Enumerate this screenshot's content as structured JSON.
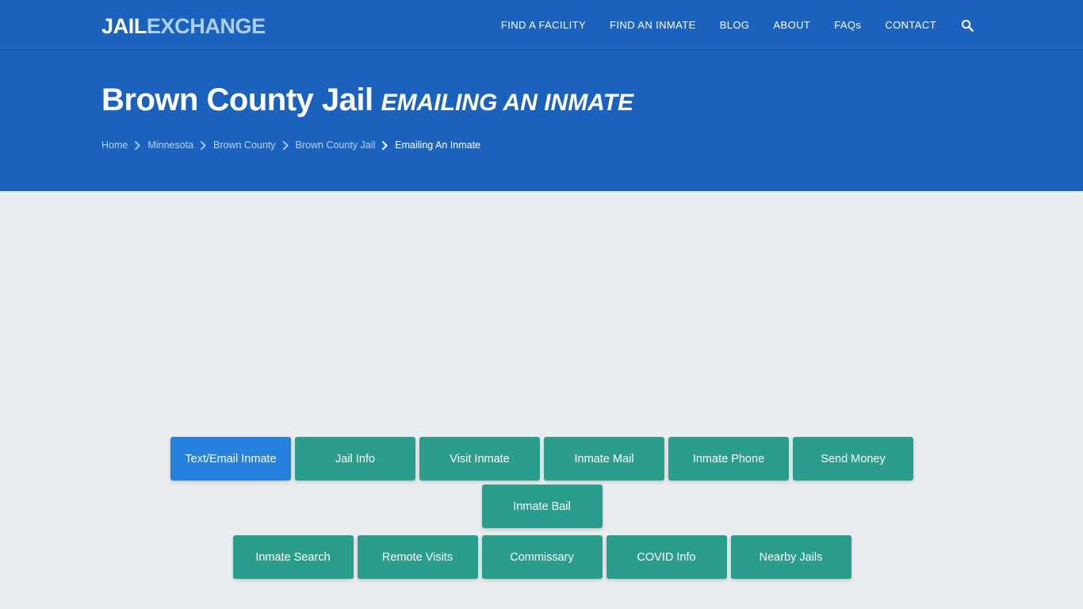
{
  "theme": {
    "header_blue": "#1b62bf",
    "active_blue": "#2680dd",
    "teal": "#2a9d8c",
    "body_bg": "#e9edf0",
    "logo_accent": "#aed0f0"
  },
  "header": {
    "logo": {
      "primary": "JAIL",
      "accent": "EXCHANGE"
    },
    "nav": [
      {
        "label": "FIND A FACILITY"
      },
      {
        "label": "FIND AN INMATE"
      },
      {
        "label": "BLOG"
      },
      {
        "label": "ABOUT"
      },
      {
        "label": "FAQs"
      },
      {
        "label": "CONTACT"
      }
    ],
    "search_icon": "search-icon"
  },
  "hero": {
    "title": "Brown County Jail",
    "subtitle": "EMAILING AN INMATE",
    "breadcrumb": [
      {
        "label": "Home",
        "current": false
      },
      {
        "label": "Minnesota",
        "current": false
      },
      {
        "label": "Brown County",
        "current": false
      },
      {
        "label": "Brown County Jail",
        "current": false
      },
      {
        "label": "Emailing An Inmate",
        "current": true
      }
    ]
  },
  "facility_nav": {
    "row1": [
      {
        "label": "Text/Email Inmate",
        "active": true
      },
      {
        "label": "Jail Info",
        "active": false
      },
      {
        "label": "Visit Inmate",
        "active": false
      },
      {
        "label": "Inmate Mail",
        "active": false
      },
      {
        "label": "Inmate Phone",
        "active": false
      },
      {
        "label": "Send Money",
        "active": false
      },
      {
        "label": "Inmate Bail",
        "active": false
      }
    ],
    "row2": [
      {
        "label": "Inmate Search",
        "active": false
      },
      {
        "label": "Remote Visits",
        "active": false
      },
      {
        "label": "Commissary",
        "active": false
      },
      {
        "label": "COVID Info",
        "active": false
      },
      {
        "label": "Nearby Jails",
        "active": false
      }
    ]
  }
}
